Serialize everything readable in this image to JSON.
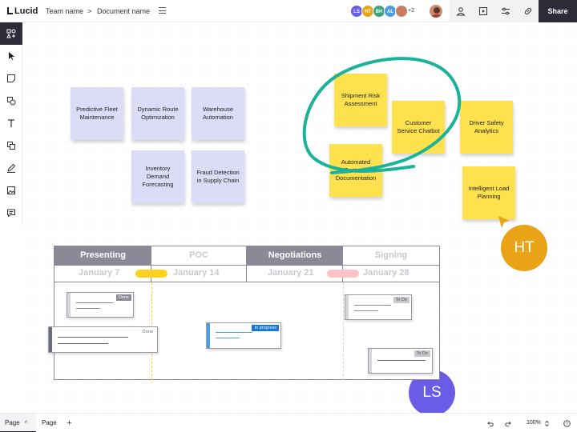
{
  "app": {
    "brand": "Lucid",
    "team": "Team name",
    "separator": ">",
    "document": "Document name"
  },
  "collaborators": [
    {
      "initials": "LS",
      "color": "#6b5ce7"
    },
    {
      "initials": "HT",
      "color": "#e8a317"
    },
    {
      "initials": "BH",
      "color": "#3aa57a"
    },
    {
      "initials": "AL",
      "color": "#4d9de0"
    },
    {
      "initials": "",
      "color": "#c97b63"
    }
  ],
  "more_collaborators": "+2",
  "share_label": "Share",
  "stickies_purple": [
    {
      "text": "Predictive Fleet Maintenance"
    },
    {
      "text": "Dynamic Route Optimization"
    },
    {
      "text": "Warehouse Automation"
    },
    {
      "text": "Inventory Demand Forecasting"
    },
    {
      "text": "Fraud Detection in Supply Chain"
    }
  ],
  "stickies_yellow": [
    {
      "text": "Shipment Risk Assessment"
    },
    {
      "text": "Customer Service Chatbot"
    },
    {
      "text": "Driver Safety Analytics"
    },
    {
      "text": "Automated Customs Documentation"
    },
    {
      "text": "Intelligent Load Planning"
    }
  ],
  "cursors": [
    {
      "initials": "HT",
      "color": "#e8a317"
    },
    {
      "initials": "LS",
      "color": "#6b5ce7"
    }
  ],
  "timeline": {
    "phases": [
      "Presenting",
      "POC",
      "Negotiations",
      "Signing"
    ],
    "dates": [
      "January 7",
      "January 14",
      "January 21",
      "January 28"
    ],
    "cards": [
      {
        "status": "Done"
      },
      {
        "status": "Done"
      },
      {
        "status": "In progress"
      },
      {
        "status": "To Do"
      },
      {
        "status": "To Do"
      }
    ]
  },
  "bottom": {
    "page_active": "Page",
    "page_other": "Page",
    "zoom": "100%"
  },
  "colors": {
    "accent_teal": "#1ab39a",
    "dark": "#2c2c38",
    "sticky_yellow": "#ffe14d",
    "sticky_purple": "#dcdcf7",
    "pill_yellow": "#ffd21f",
    "pill_pink": "#ffc2c7"
  }
}
